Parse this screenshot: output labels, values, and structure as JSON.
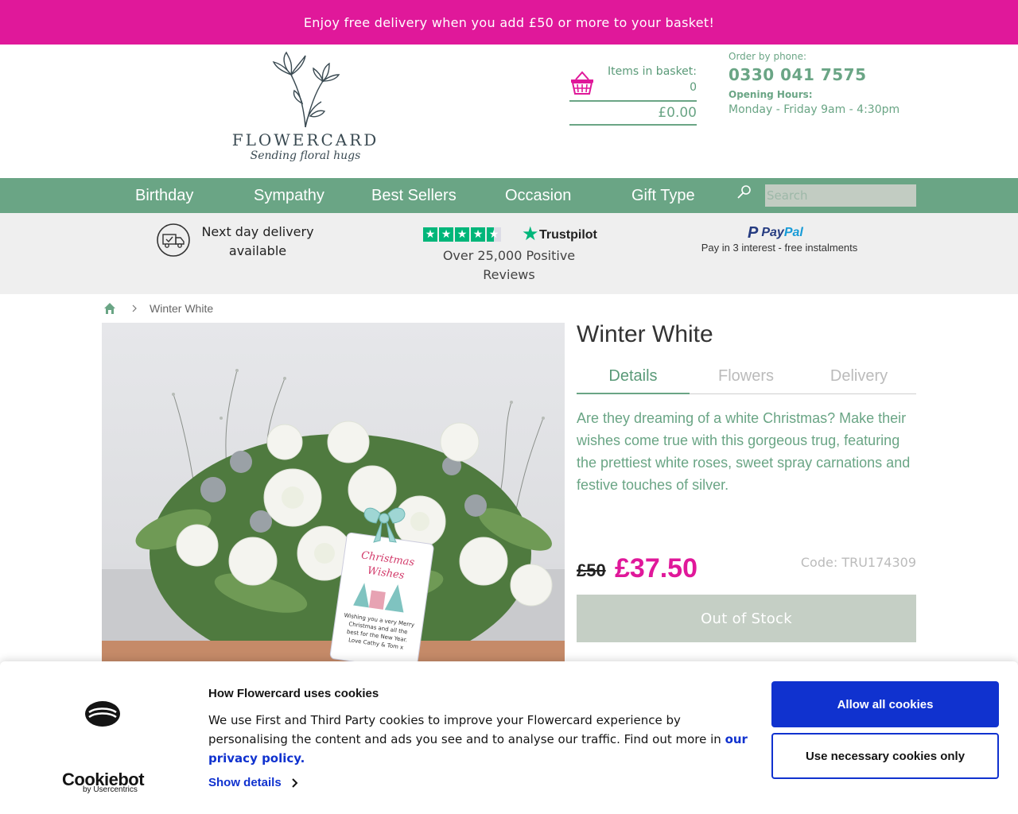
{
  "promo": {
    "text": "Enjoy free delivery when you add £50 or more to your basket!"
  },
  "brand": {
    "name": "FLOWERCARD",
    "tagline": "Sending floral hugs"
  },
  "basket": {
    "items_label": "Items in basket:",
    "items_count": "0",
    "total": "£0.00",
    "icon": "basket-icon"
  },
  "contact": {
    "order_label": "Order by phone:",
    "phone": "0330 041 7575",
    "hours_label": "Opening Hours:",
    "hours": "Monday - Friday 9am - 4:30pm"
  },
  "nav": {
    "items": [
      "Birthday",
      "Sympathy",
      "Best Sellers",
      "Occasion",
      "Gift Type"
    ],
    "search_placeholder": "Search"
  },
  "trust": {
    "delivery_line1": "Next day delivery",
    "delivery_line2": "available",
    "trustpilot_name": "Trustpilot",
    "reviews_line1": "Over 25,000 Positive",
    "reviews_line2": "Reviews",
    "rating_stars": 4.5,
    "paypal_pay": "Pay",
    "paypal_pal": "Pal",
    "paypal_text": "Pay in 3 interest - free instalments"
  },
  "breadcrumb": {
    "current": "Winter White"
  },
  "product": {
    "title": "Winter White",
    "tabs": [
      "Details",
      "Flowers",
      "Delivery"
    ],
    "active_tab": "Details",
    "description": "Are they dreaming of a white Christmas? Make their wishes come true with this gorgeous trug, featuring the prettiest white roses, sweet spray carnations and festive touches of silver.",
    "old_price": "£50",
    "price": "£37.50",
    "code": "Code: TRU174309",
    "stock_button": "Out of Stock",
    "card": {
      "heading1": "Christmas",
      "heading2": "Wishes",
      "line1": "Wishing you a very Merry",
      "line2": "Christmas and all the",
      "line3": "best for the New Year.",
      "line4": "Love Cathy & Tom x"
    }
  },
  "cookie": {
    "title": "How Flowercard uses cookies",
    "text": "We use First and Third Party cookies to improve your Flowercard experience by personalising the content and ads you see and to analyse our traffic. Find out more in ",
    "link": "our privacy policy.",
    "show_details": "Show details",
    "allow_all": "Allow all cookies",
    "necessary_only": "Use necessary cookies only",
    "brand": "Cookiebot",
    "brand_sub": "by Usercentrics"
  },
  "colors": {
    "accent_pink": "#e0189a",
    "brand_green": "#6aa585",
    "cookie_blue": "#1032cf"
  }
}
